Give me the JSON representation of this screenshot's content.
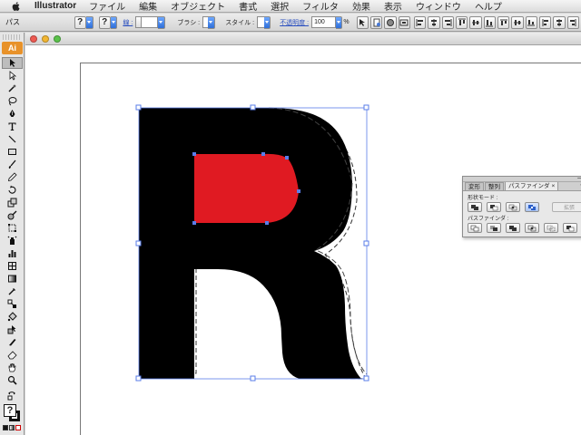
{
  "menubar": {
    "app_name": "Illustrator",
    "items": [
      "ファイル",
      "編集",
      "オブジェクト",
      "書式",
      "選択",
      "フィルタ",
      "効果",
      "表示",
      "ウィンドウ",
      "ヘルプ"
    ]
  },
  "controlbar": {
    "object_type": "パス",
    "fill_symbol": "?",
    "stroke_symbol": "?",
    "stroke_weight_label": "線 :",
    "brush_label": "ブラシ :",
    "style_label": "スタイル :",
    "opacity_label": "不透明度 :",
    "opacity_value": "100",
    "percent": "%"
  },
  "tools": {
    "logo": "Ai",
    "items": [
      "selection",
      "direct-selection",
      "magic-wand",
      "lasso",
      "pen",
      "type",
      "line-segment",
      "rectangle",
      "paintbrush",
      "pencil",
      "rotate",
      "scale",
      "warp",
      "free-transform",
      "symbol-sprayer",
      "column-graph",
      "mesh",
      "gradient",
      "eyedropper",
      "blend",
      "live-paint-bucket",
      "live-paint-selection",
      "slice",
      "eraser",
      "hand",
      "zoom"
    ]
  },
  "document": {
    "traffic_lights": [
      "#ee5a52",
      "#f2b632",
      "#5ac24a"
    ]
  },
  "artwork": {
    "letter": "R",
    "fill_color": "#000000",
    "highlight_color": "#e01a22",
    "selection_color": "#5a7de8"
  },
  "pathfinder": {
    "tabs": [
      "変形",
      "整列",
      "パスファインダ"
    ],
    "active_tab": "パスファインダ",
    "close_symbol": "×",
    "shape_modes_label": "形状モード :",
    "expand_label": "拡張",
    "pathfinders_label": "パスファインダ :"
  }
}
